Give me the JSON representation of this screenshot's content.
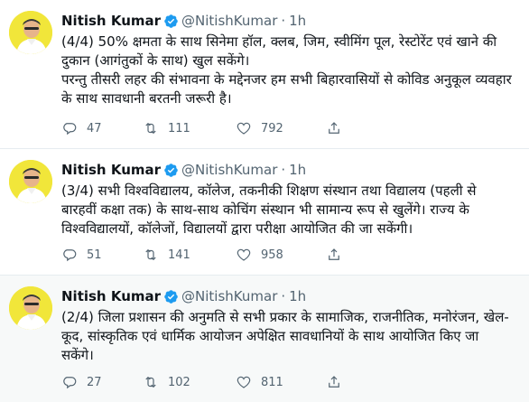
{
  "tweets": [
    {
      "name": "Nitish Kumar",
      "handle": "@NitishKumar",
      "separator": "·",
      "time": "1h",
      "text_lines": [
        "(4/4) 50% क्षमता के साथ सिनेमा हॉल, क्लब, जिम, स्वीमिंग पूल, रेस्टोरेंट एवं खाने की दुकान (आगंतुकों के साथ) खुल सकेंगे।",
        "परन्तु तीसरी लहर की संभावना के मद्देनजर हम सभी बिहारवासियों से कोविड अनुकूल व्यवहार के साथ सावधानी बरतनी जरूरी है।"
      ],
      "replies": "47",
      "retweets": "111",
      "likes": "792"
    },
    {
      "name": "Nitish Kumar",
      "handle": "@NitishKumar",
      "separator": "·",
      "time": "1h",
      "text_lines": [
        "(3/4) सभी विश्वविद्यालय, कॉलेज, तकनीकी शिक्षण संस्थान तथा विद्यालय (पहली से बारहवीं कक्षा तक) के साथ-साथ कोचिंग संस्थान भी सामान्य रूप से खुलेंगे। राज्य के विश्वविद्यालयों, कॉलेजों, विद्यालयों द्वारा परीक्षा आयोजित की जा सकेंगी।"
      ],
      "replies": "51",
      "retweets": "141",
      "likes": "958"
    },
    {
      "name": "Nitish Kumar",
      "handle": "@NitishKumar",
      "separator": "·",
      "time": "1h",
      "text_lines": [
        "(2/4) जिला प्रशासन की अनुमति से सभी प्रकार के सामाजिक, राजनीतिक, मनोरंजन, खेल-कूद, सांस्कृतिक एवं धार्मिक आयोजन अपेक्षित सावधानियों के साथ आयोजित किए जा सकेंगे।"
      ],
      "replies": "27",
      "retweets": "102",
      "likes": "811"
    }
  ],
  "icons": {
    "verified": "verified-badge-icon",
    "reply": "reply-icon",
    "retweet": "retweet-icon",
    "like": "heart-icon",
    "share": "share-icon"
  },
  "colors": {
    "verified_badge": "#1d9bf0",
    "avatar_background": "#f1e63a",
    "secondary_text": "#536471"
  }
}
